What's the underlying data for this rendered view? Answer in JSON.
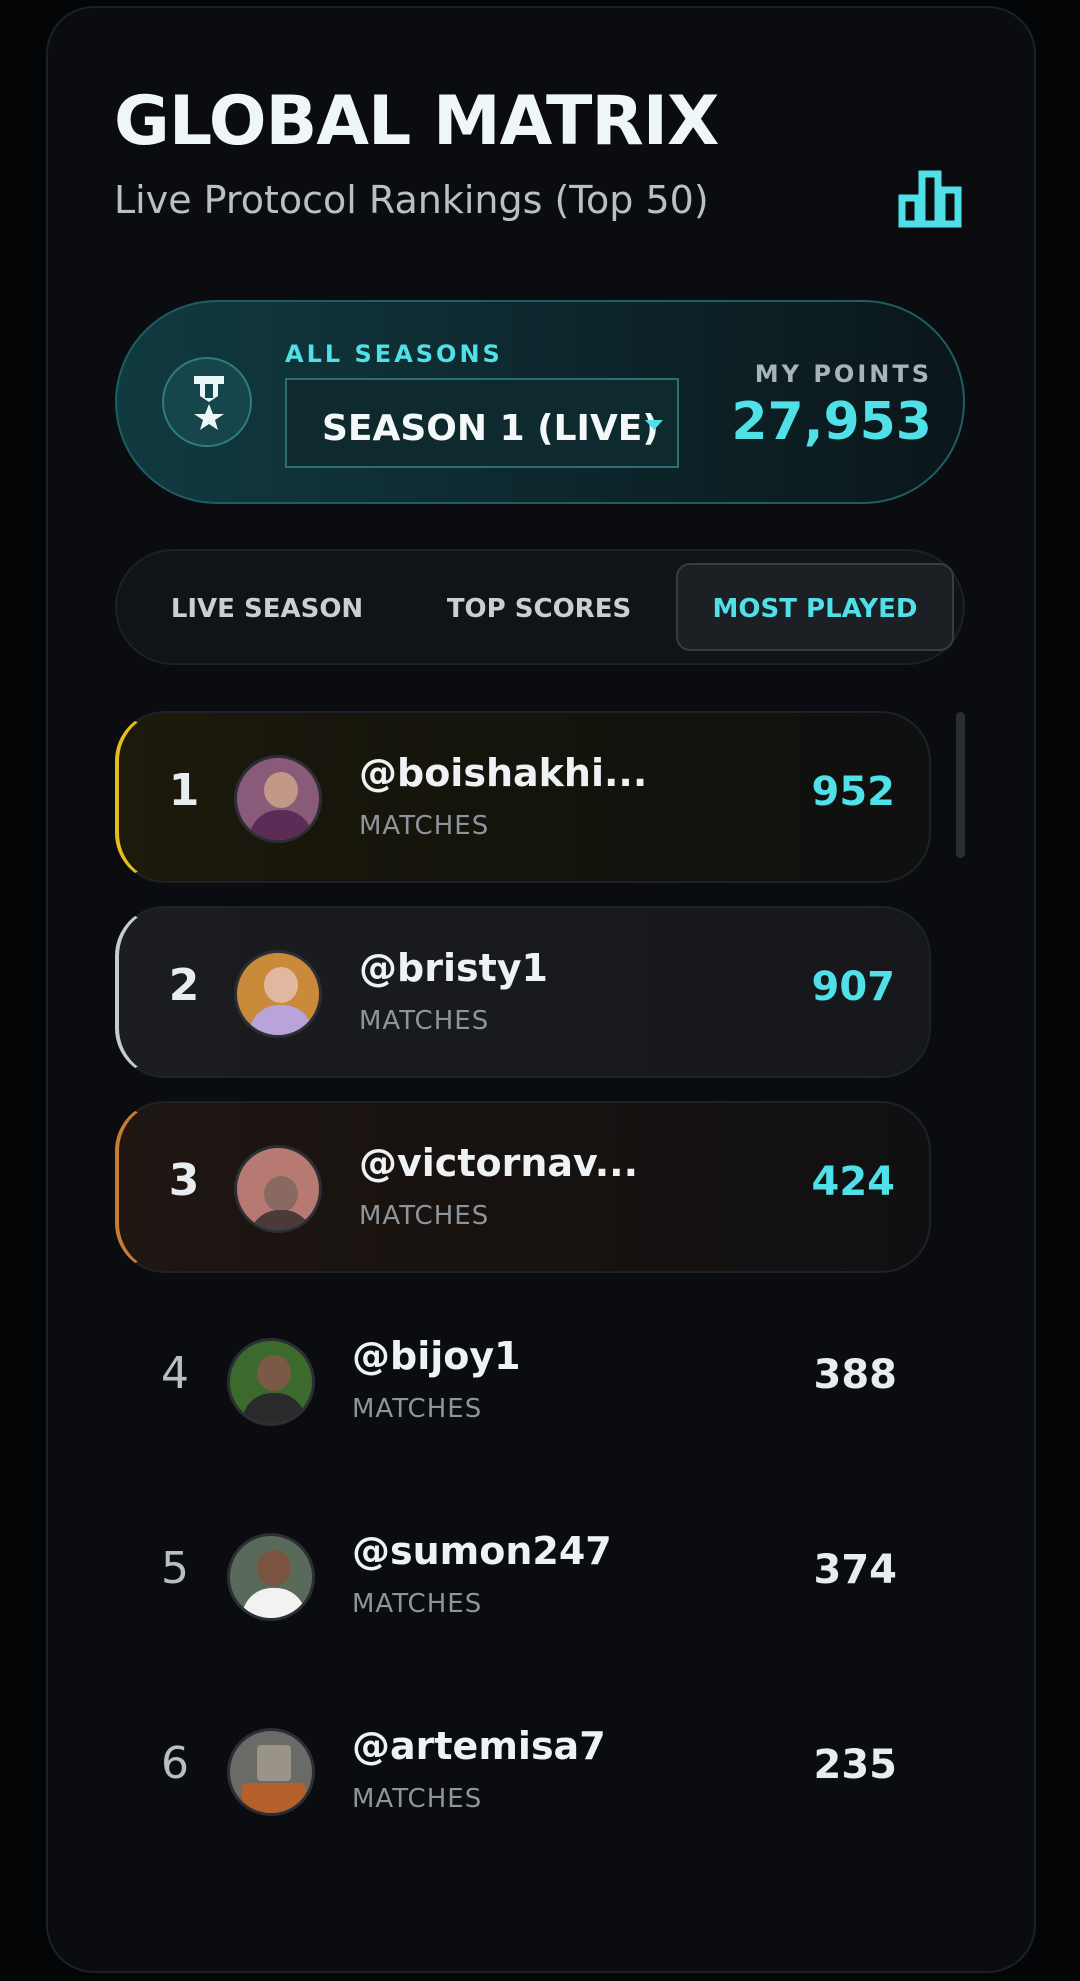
{
  "header": {
    "title": "GLOBAL MATRIX",
    "subtitle": "Live Protocol Rankings (Top 50)",
    "chart_icon": "bar-chart-icon"
  },
  "season": {
    "label": "ALL SEASONS",
    "selected": "SEASON 1 (LIVE)",
    "my_points_label": "MY POINTS",
    "my_points": "27,953",
    "medal_icon": "medal-icon"
  },
  "tabs": [
    {
      "label": "LIVE SEASON",
      "active": false
    },
    {
      "label": "TOP SCORES",
      "active": false
    },
    {
      "label": "MOST PLAYED",
      "active": true
    }
  ],
  "rankings": [
    {
      "rank": "1",
      "handle": "@boishakhi...",
      "sub": "MATCHES",
      "score": "952"
    },
    {
      "rank": "2",
      "handle": "@bristy1",
      "sub": "MATCHES",
      "score": "907"
    },
    {
      "rank": "3",
      "handle": "@victornav...",
      "sub": "MATCHES",
      "score": "424"
    },
    {
      "rank": "4",
      "handle": "@bijoy1",
      "sub": "MATCHES",
      "score": "388"
    },
    {
      "rank": "5",
      "handle": "@sumon247",
      "sub": "MATCHES",
      "score": "374"
    },
    {
      "rank": "6",
      "handle": "@artemisa7",
      "sub": "MATCHES",
      "score": "235"
    }
  ],
  "colors": {
    "accent": "#4fe0e8",
    "gold": "#e8bc1c",
    "silver": "#c8cbd0",
    "bronze": "#c77c35"
  }
}
